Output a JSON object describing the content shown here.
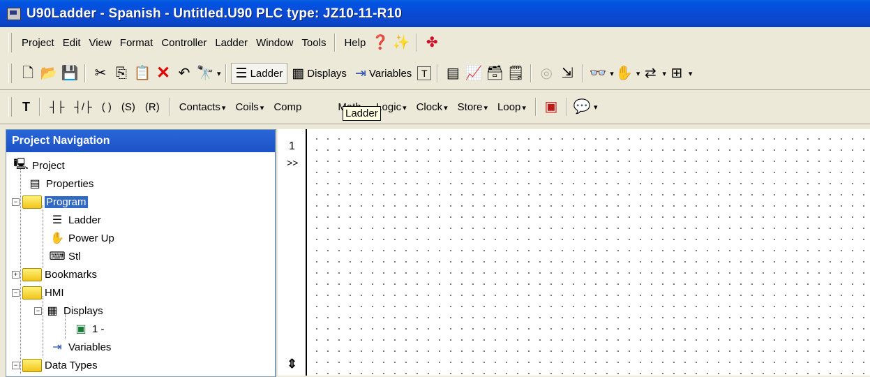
{
  "window": {
    "title": "U90Ladder - Spanish - Untitled.U90   PLC type: JZ10-11-R10"
  },
  "menu": {
    "items": [
      "Project",
      "Edit",
      "View",
      "Format",
      "Controller",
      "Ladder",
      "Window",
      "Tools",
      "Help"
    ]
  },
  "toolbar1": {
    "ladder_label": "Ladder",
    "displays_label": "Displays",
    "variables_label": "Variables"
  },
  "toolbar2": {
    "element_glyphs": [
      "T",
      "┤├",
      "┤/├",
      "( )",
      "(S)",
      "(R)"
    ],
    "items": [
      "Contacts",
      "Coils",
      "Comp",
      "Math",
      "Logic",
      "Clock",
      "Store",
      "Loop"
    ],
    "tooltip": "Ladder"
  },
  "nav": {
    "header": "Project Navigation",
    "tree": {
      "project": "Project",
      "properties": "Properties",
      "program": "Program",
      "ladder": "Ladder",
      "power_up": "Power Up",
      "stl": "Stl",
      "bookmarks": "Bookmarks",
      "hmi": "HMI",
      "displays": "Displays",
      "display_1": "1 -",
      "variables": "Variables",
      "data_types": "Data Types"
    }
  },
  "ladder_editor": {
    "rung_number": "1",
    "rung_marker": ">>"
  },
  "colors": {
    "titlebar": "#0054e3",
    "selection": "#316ac5",
    "delete_x": "#e00000"
  }
}
